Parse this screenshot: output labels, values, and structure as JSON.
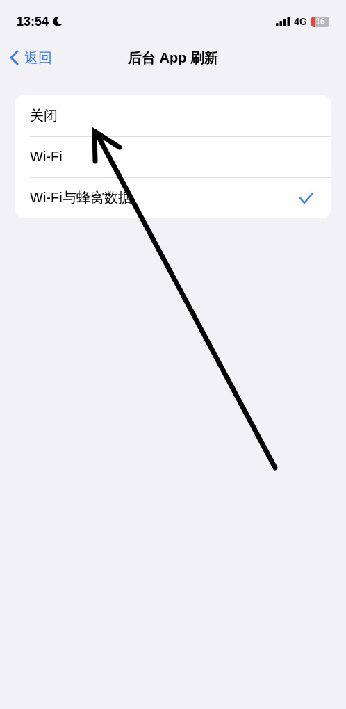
{
  "status_bar": {
    "time": "13:54",
    "network": "4G",
    "battery": "16"
  },
  "nav": {
    "back": "返回",
    "title": "后台 App 刷新"
  },
  "options": [
    {
      "label": "关闭",
      "selected": false
    },
    {
      "label": "Wi-Fi",
      "selected": false
    },
    {
      "label": "Wi-Fi与蜂窝数据",
      "selected": true
    }
  ]
}
